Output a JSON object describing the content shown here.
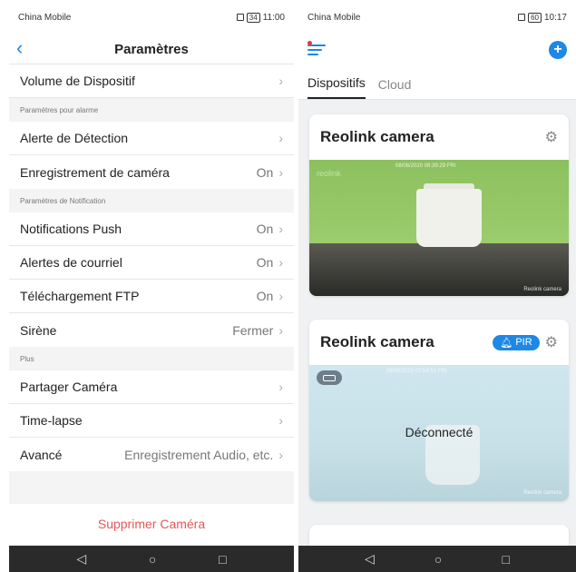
{
  "left": {
    "status": {
      "carrier": "China Mobile",
      "battery": "34",
      "time": "11:00"
    },
    "header": {
      "title": "Paramètres"
    },
    "rows": {
      "volume": {
        "label": "Volume de Dispositif",
        "value": ""
      },
      "section_alarm": "Paramètres pour alarme",
      "detection": {
        "label": "Alerte de Détection",
        "value": ""
      },
      "recording": {
        "label": "Enregistrement de caméra",
        "value": "On"
      },
      "section_notif": "Paramètres de Notification",
      "push": {
        "label": "Notifications Push",
        "value": "On"
      },
      "email": {
        "label": "Alertes de courriel",
        "value": "On"
      },
      "ftp": {
        "label": "Téléchargement FTP",
        "value": "On"
      },
      "siren": {
        "label": "Sirène",
        "value": "Fermer"
      },
      "section_more": "Plus",
      "share": {
        "label": "Partager Caméra",
        "value": ""
      },
      "timelapse": {
        "label": "Time-lapse",
        "value": ""
      },
      "advanced": {
        "label": "Avancé",
        "value": "Enregistrement Audio, etc."
      }
    },
    "delete_label": "Supprimer Caméra"
  },
  "right": {
    "status": {
      "carrier": "China Mobile",
      "battery": "60",
      "time": "10:17"
    },
    "tabs": [
      "Dispositifs",
      "Cloud"
    ],
    "cards": [
      {
        "name": "Reolink camera",
        "timestamp": "08/08/2020 08:39:29 FRI",
        "watermark": "Reolink camera",
        "overlay": "reolink"
      },
      {
        "name": "Reolink camera",
        "badge": "PIR",
        "status": "Déconnecté",
        "timestamp": "08/08/2020 07:54:51 FRI",
        "watermark": "Reolink camera"
      }
    ]
  },
  "colors": {
    "accent": "#1e88e5",
    "danger": "#e45757",
    "red_dot": "#e53935"
  }
}
